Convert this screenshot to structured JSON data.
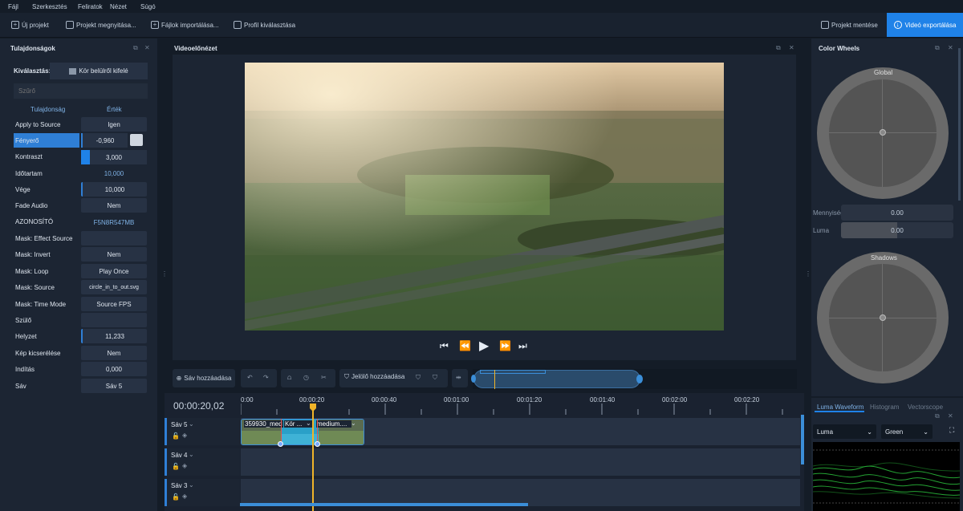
{
  "menu": {
    "items": [
      "Fájl",
      "Szerkesztés",
      "Feliratok",
      "Nézet",
      "Súgó"
    ]
  },
  "toolbar": {
    "new_project": "Új projekt",
    "open_project": "Projekt megnyitása...",
    "import_files": "Fájlok importálása...",
    "choose_profile": "Profil kiválasztása",
    "save_project": "Projekt mentése",
    "export_video": "Videó exportálása"
  },
  "properties": {
    "title": "Tulajdonságok",
    "selection_label": "Kiválasztás:",
    "selection_value": "Kör belülről kifelé",
    "filter_placeholder": "Szűrő",
    "col_property": "Tulajdonság",
    "col_value": "Érték",
    "rows": [
      {
        "label": "Apply to Source",
        "value": "Igen"
      },
      {
        "label": "Fényerő",
        "value": "-0,960"
      },
      {
        "label": "Kontraszt",
        "value": "3,000"
      },
      {
        "label": "Időtartam",
        "value": "10,000"
      },
      {
        "label": "Vége",
        "value": "10,000"
      },
      {
        "label": "Fade Audio",
        "value": "Nem"
      },
      {
        "label": "AZONOSÍTÓ",
        "value": "F5N8R547MB"
      },
      {
        "label": "Mask: Effect Source",
        "value": ""
      },
      {
        "label": "Mask: Invert",
        "value": "Nem"
      },
      {
        "label": "Mask: Loop",
        "value": "Play Once"
      },
      {
        "label": "Mask: Source",
        "value": "circle_in_to_out.svg"
      },
      {
        "label": "Mask: Time Mode",
        "value": "Source FPS"
      },
      {
        "label": "Szülő",
        "value": ""
      },
      {
        "label": "Helyzet",
        "value": "11,233"
      },
      {
        "label": "Kép kicserélése",
        "value": "Nem"
      },
      {
        "label": "Indítás",
        "value": "0,000"
      },
      {
        "label": "Sáv",
        "value": "Sáv 5"
      }
    ]
  },
  "preview": {
    "title": "Videoelőnézet"
  },
  "timeline_toolbar": {
    "add_track": "Sáv hozzáadása",
    "add_marker": "Jelölő hozzáadása"
  },
  "timeline": {
    "timecode": "00:00:20,02",
    "ruler": [
      "0:00",
      "00:00:20",
      "00:00:40",
      "00:01:00",
      "00:01:20",
      "00:01:40",
      "00:02:00",
      "00:02:20"
    ],
    "tracks": [
      "Sáv 5",
      "Sáv 4",
      "Sáv 3"
    ],
    "clips": [
      {
        "label": "359930_med"
      },
      {
        "label": "Kör ..."
      },
      {
        "label": "medium...."
      }
    ],
    "playhead_accent": "#f0b429"
  },
  "color_wheels": {
    "title": "Color Wheels",
    "global_label": "Global",
    "shadows_label": "Shadows",
    "amount_label": "Mennyiség",
    "amount_value": "0.00",
    "luma_label": "Luma",
    "luma_value": "0.00"
  },
  "scopes": {
    "tabs": [
      "Luma Waveform",
      "Histogram",
      "Vectorscope"
    ],
    "channel_select": "Luma",
    "color_select": "Green"
  },
  "colors": {
    "accent": "#1f82e8",
    "playhead": "#f0b429",
    "waveform": "#2ecc40"
  }
}
